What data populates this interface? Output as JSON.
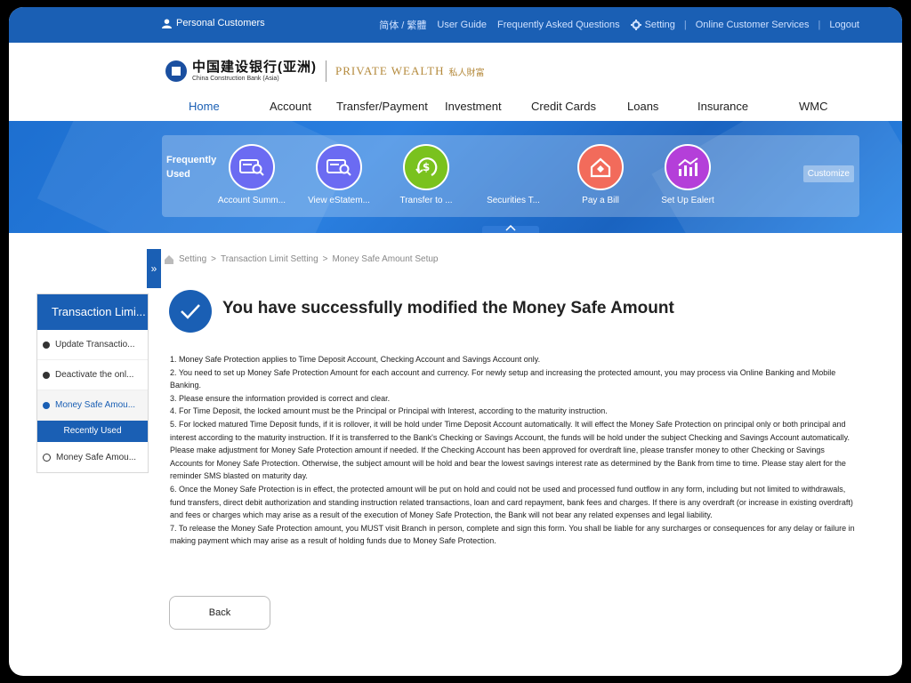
{
  "topbar": {
    "personal": "Personal Customers",
    "lang": "简体 / 繁體",
    "user_guide": "User Guide",
    "faq": "Frequently Asked Questions",
    "setting": "Setting",
    "online_cs": "Online Customer Services",
    "logout": "Logout"
  },
  "brand": {
    "cn": "中国建设银行(亚洲)",
    "en": "China Construction Bank (Asia)",
    "private_wealth": "PRIVATE WEALTH",
    "private_wealth_cn": "私人財富"
  },
  "nav": {
    "items": [
      "Home",
      "Account",
      "Transfer/Payment",
      "Investment",
      "Credit Cards",
      "Loans",
      "Insurance",
      "WMC"
    ]
  },
  "frequently_used": {
    "label_line1": "Frequently",
    "label_line2": "Used",
    "items": [
      {
        "label": "Account Summ...",
        "color": "#6b6bf2",
        "icon": "account-summary-icon"
      },
      {
        "label": "View eStatem...",
        "color": "#6b6bf2",
        "icon": "estatement-icon"
      },
      {
        "label": "Transfer to ...",
        "color": "#7ac21e",
        "icon": "transfer-icon"
      },
      {
        "label": "Securities T...",
        "color": "",
        "icon": ""
      },
      {
        "label": "Pay a Bill",
        "color": "#f26b5b",
        "icon": "pay-bill-icon"
      },
      {
        "label": "Set Up Ealert",
        "color": "#b43fd9",
        "icon": "ealert-icon"
      }
    ],
    "customize": "Customize"
  },
  "breadcrumb": {
    "items": [
      "Setting",
      "Transaction Limit Setting",
      "Money Safe Amount Setup"
    ]
  },
  "left_menu": {
    "title": "Transaction Limi...",
    "items": [
      "Update Transactio...",
      "Deactivate the onl...",
      "Money Safe Amou..."
    ],
    "recent_label": "Recently Used",
    "recent_items": [
      "Money Safe Amou..."
    ]
  },
  "main": {
    "title": "You have successfully modified the Money Safe Amount",
    "notes": [
      "1. Money Safe Protection applies to Time Deposit Account, Checking Account and Savings Account only.",
      "2. You need to set up Money Safe Protection Amount for each account and currency. For newly setup and increasing the protected amount, you may process via Online Banking and Mobile Banking.",
      "3. Please ensure the information provided is correct and clear.",
      "4. For Time Deposit, the locked amount must be the Principal or Principal with Interest, according to the maturity instruction.",
      "5. For locked matured Time Deposit funds, if it is rollover, it will be hold under Time Deposit Account automatically. It will effect the Money Safe Protection on principal only or both principal and interest according to the maturity instruction. If it is transferred to the Bank's Checking or Savings Account, the funds will be hold under the subject Checking and Savings Account automatically. Please make adjustment for Money Safe Protection amount if needed. If the Checking Account has been approved for overdraft line, please transfer money to other Checking or Savings Accounts for Money Safe Protection. Otherwise, the subject amount will be hold and bear the lowest savings interest rate as determined by the Bank from time to time. Please stay alert for the reminder SMS blasted on maturity day.",
      "6. Once the Money Safe Protection is in effect, the protected amount will be put on hold and could not be used and processed fund outflow in any form, including but not limited to withdrawals, fund transfers, direct debit authorization and standing instruction related transactions, loan and card repayment, bank fees and charges. If there is any overdraft (or increase in existing overdraft) and fees or charges which may arise as a result of the execution of Money Safe Protection, the Bank will not bear any related expenses and legal liability.",
      "7. To release the Money Safe Protection amount, you MUST visit Branch in person, complete and sign this form. You shall be liable for any surcharges or consequences for any delay or failure in making payment which may arise as a result of holding funds due to Money Safe Protection."
    ],
    "back_label": "Back"
  },
  "colors": {
    "brand_blue": "#1a5fb4",
    "active_nav": "#1a5fb4"
  }
}
